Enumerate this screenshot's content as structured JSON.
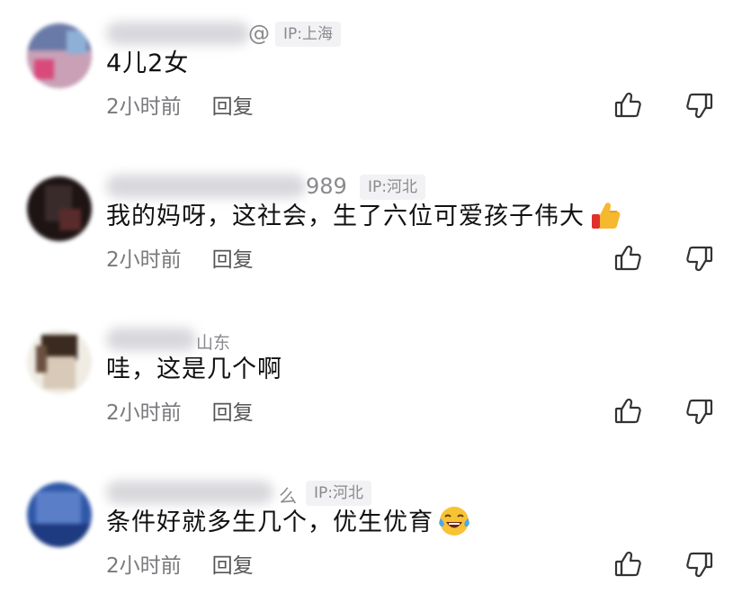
{
  "comments": [
    {
      "username_visible": "@",
      "ip": "IP:上海",
      "text": "4儿2女",
      "time": "2小时前",
      "reply_label": "回复",
      "avatar_colors": [
        "#6a7aa8",
        "#c9a0b6",
        "#d94a7a",
        "#8fb0d6"
      ]
    },
    {
      "username_visible": "989",
      "ip": "IP:河北",
      "text": "我的妈呀，这社会，生了六位可爱孩子伟大",
      "emoji": "thumbs-up-emoji",
      "time": "2小时前",
      "reply_label": "回复",
      "avatar_colors": [
        "#1e1414",
        "#3a2b2b",
        "#5a2b2b",
        "#2b2020"
      ]
    },
    {
      "username_visible": "山东",
      "ip": "",
      "text": "哇，这是几个啊",
      "time": "2小时前",
      "reply_label": "回复",
      "avatar_colors": [
        "#3a2a20",
        "#d8c9b8",
        "#6a5040",
        "#f0ece4"
      ]
    },
    {
      "username_visible": "么",
      "ip": "IP:河北",
      "text": "条件好就多生几个，优生优育",
      "emoji": "laughing-tears-emoji",
      "time": "2小时前",
      "reply_label": "回复",
      "avatar_colors": [
        "#3058a8",
        "#5a7ec8",
        "#1e3a80",
        "#7a9ad8"
      ]
    }
  ],
  "icons": {
    "like": "thumbs-up-icon",
    "dislike": "thumbs-down-icon"
  },
  "colors": {
    "meta": "#7a7a7e",
    "ip_tag_bg": "#f2f2f4",
    "text": "#111111"
  }
}
